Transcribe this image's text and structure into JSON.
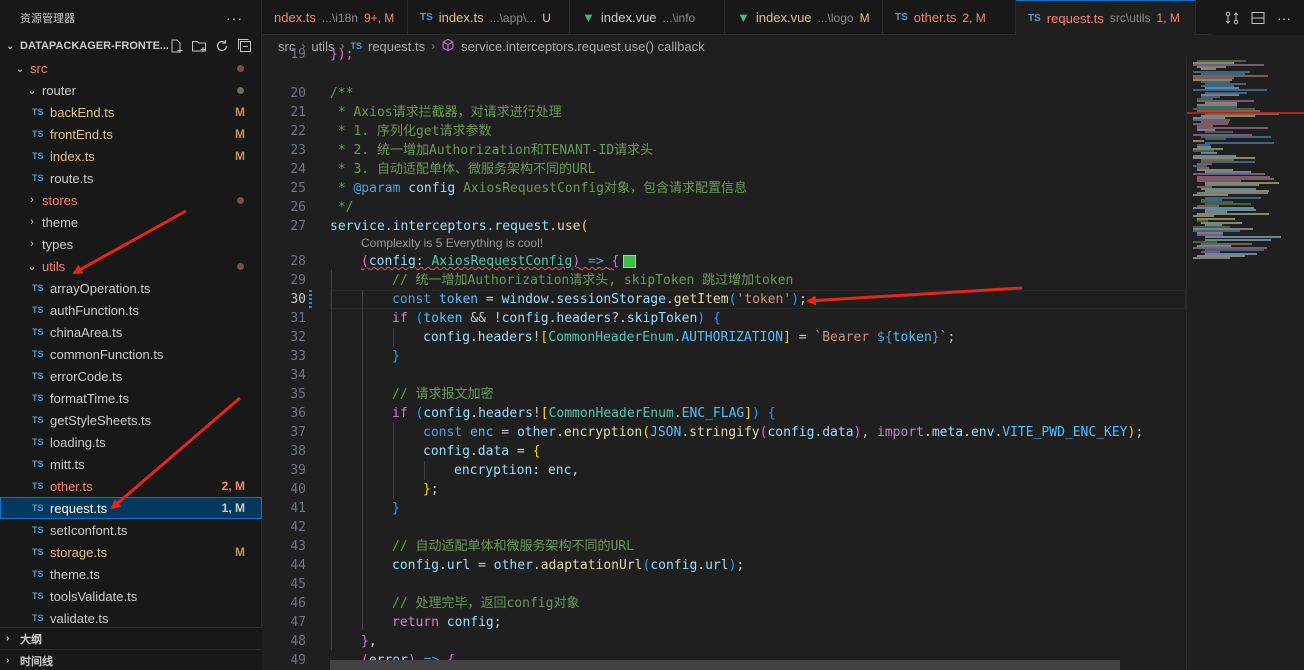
{
  "explorer": {
    "title": "资源管理器",
    "more_icon": "ellipsis-icon",
    "project_name": "DATAPACKAGER-FRONTE...",
    "project_actions": [
      "new-file-icon",
      "new-folder-icon",
      "refresh-icon",
      "collapse-all-icon"
    ],
    "tree": [
      {
        "label": "src",
        "kind": "folder-open",
        "depth": 1,
        "state": "err",
        "dot": true
      },
      {
        "label": "router",
        "kind": "folder-open",
        "depth": 2,
        "state": "",
        "dot": true,
        "dotgray": true
      },
      {
        "label": "backEnd.ts",
        "kind": "ts",
        "depth": 3,
        "state": "mod",
        "badge": "M"
      },
      {
        "label": "frontEnd.ts",
        "kind": "ts",
        "depth": 3,
        "state": "mod",
        "badge": "M"
      },
      {
        "label": "index.ts",
        "kind": "ts",
        "depth": 3,
        "state": "mod",
        "badge": "M"
      },
      {
        "label": "route.ts",
        "kind": "ts",
        "depth": 3,
        "state": "",
        "badge": ""
      },
      {
        "label": "stores",
        "kind": "folder",
        "depth": 2,
        "state": "err",
        "dot": true
      },
      {
        "label": "theme",
        "kind": "folder",
        "depth": 2,
        "state": ""
      },
      {
        "label": "types",
        "kind": "folder",
        "depth": 2,
        "state": ""
      },
      {
        "label": "utils",
        "kind": "folder-open",
        "depth": 2,
        "state": "err",
        "dot": true
      },
      {
        "label": "arrayOperation.ts",
        "kind": "ts",
        "depth": 3,
        "state": ""
      },
      {
        "label": "authFunction.ts",
        "kind": "ts",
        "depth": 3,
        "state": ""
      },
      {
        "label": "chinaArea.ts",
        "kind": "ts",
        "depth": 3,
        "state": ""
      },
      {
        "label": "commonFunction.ts",
        "kind": "ts",
        "depth": 3,
        "state": ""
      },
      {
        "label": "errorCode.ts",
        "kind": "ts",
        "depth": 3,
        "state": ""
      },
      {
        "label": "formatTime.ts",
        "kind": "ts",
        "depth": 3,
        "state": ""
      },
      {
        "label": "getStyleSheets.ts",
        "kind": "ts",
        "depth": 3,
        "state": ""
      },
      {
        "label": "loading.ts",
        "kind": "ts",
        "depth": 3,
        "state": ""
      },
      {
        "label": "mitt.ts",
        "kind": "ts",
        "depth": 3,
        "state": ""
      },
      {
        "label": "other.ts",
        "kind": "ts",
        "depth": 3,
        "state": "err",
        "badge": "2, M"
      },
      {
        "label": "request.ts",
        "kind": "ts",
        "depth": 3,
        "state": "sel",
        "badge": "1, M"
      },
      {
        "label": "setIconfont.ts",
        "kind": "ts",
        "depth": 3,
        "state": ""
      },
      {
        "label": "storage.ts",
        "kind": "ts",
        "depth": 3,
        "state": "mod",
        "badge": "M"
      },
      {
        "label": "theme.ts",
        "kind": "ts",
        "depth": 3,
        "state": ""
      },
      {
        "label": "toolsValidate.ts",
        "kind": "ts",
        "depth": 3,
        "state": ""
      },
      {
        "label": "validate.ts",
        "kind": "ts",
        "depth": 3,
        "state": ""
      }
    ],
    "ts_badge": "TS",
    "outline_label": "大纲",
    "timeline_label": "时间线"
  },
  "tabs": [
    {
      "icon": "",
      "name": "ndex.ts",
      "path": "...\\i18n",
      "status": "9+, M",
      "kind": "err"
    },
    {
      "icon": "TS",
      "name": "index.ts",
      "path": "...\\app\\...",
      "status": "U",
      "kind": "mod"
    },
    {
      "icon": "vue",
      "name": "index.vue",
      "path": "...\\info",
      "status": "",
      "kind": "plain"
    },
    {
      "icon": "vue",
      "name": "index.vue",
      "path": "...\\logo",
      "status": "M",
      "kind": "mod"
    },
    {
      "icon": "TS",
      "name": "other.ts",
      "path": "",
      "status": "2, M",
      "kind": "err"
    },
    {
      "icon": "TS",
      "name": "request.ts",
      "path": "src\\utils",
      "status": "1, M",
      "kind": "active"
    }
  ],
  "tab_actions": [
    "source-control-compare-icon",
    "split-editor-icon",
    "more-actions-icon"
  ],
  "breadcrumb": {
    "items": [
      "src",
      "utils",
      "request.ts",
      "service.interceptors.request.use() callback"
    ],
    "ts_badge": "TS"
  },
  "editor": {
    "line_numbers": [
      "19",
      "20",
      "21",
      "22",
      "23",
      "24",
      "25",
      "26",
      "27",
      "28",
      "29",
      "30",
      "31",
      "32",
      "33",
      "34",
      "35",
      "36",
      "37",
      "38",
      "39",
      "40",
      "41",
      "42",
      "43",
      "44",
      "45",
      "46",
      "47",
      "48",
      "49"
    ],
    "codelens": "Complexity is 5 Everything is cool!",
    "lines": {
      "l19": "});",
      "l20": "/**",
      "l21": " * Axios请求拦截器，对请求进行处理",
      "l22": " * 1. 序列化get请求参数",
      "l23": " * 2. 统一增加Authorization和TENANT-ID请求头",
      "l24": " * 3. 自动适配单体、微服务架构不同的URL",
      "l25a": " * ",
      "l25b": "@param",
      "l25c": " config",
      "l25d": " AxiosRequestConfig对象，包含请求配置信息",
      "l26": " */",
      "l27a": "service",
      "l27b": ".",
      "l27c": "interceptors",
      "l27d": ".",
      "l27e": "request",
      "l27f": ".",
      "l27g": "use",
      "l27h": "(",
      "l28a": "(",
      "l28b": "config",
      "l28c": ": ",
      "l28d": "AxiosRequestConfig",
      "l28e": ")",
      "l28f": " => ",
      "l28g": "{",
      "l29": "// 统一增加Authorization请求头, skipToken 跳过增加token",
      "l30a": "const",
      "l30b": " token",
      "l30c": " = ",
      "l30d": "window",
      "l30e": ".",
      "l30f": "sessionStorage",
      "l30g": ".",
      "l30h": "getItem",
      "l30i": "(",
      "l30j": "'token'",
      "l30k": ")",
      "l30l": ";",
      "l31a": "if",
      "l31b": " (",
      "l31c": "token",
      "l31d": " && !",
      "l31e": "config",
      "l31f": ".",
      "l31g": "headers",
      "l31h": "?.",
      "l31i": "skipToken",
      "l31j": ")",
      "l31k": " {",
      "l32a": "config",
      "l32b": ".",
      "l32c": "headers",
      "l32d": "!",
      "l32e": "[",
      "l32f": "CommonHeaderEnum",
      "l32g": ".",
      "l32h": "AUTHORIZATION",
      "l32i": "]",
      "l32j": " = ",
      "l32k": "`Bearer ",
      "l32l": "${",
      "l32m": "token",
      "l32n": "}",
      "l32o": "`",
      "l32p": ";",
      "l33": "}",
      "l35": "// 请求报文加密",
      "l36a": "if",
      "l36b": " (",
      "l36c": "config",
      "l36d": ".",
      "l36e": "headers",
      "l36f": "!",
      "l36g": "[",
      "l36h": "CommonHeaderEnum",
      "l36i": ".",
      "l36j": "ENC_FLAG",
      "l36k": "]",
      "l36l": ")",
      "l36m": " {",
      "l37a": "const",
      "l37b": " enc",
      "l37c": " = ",
      "l37d": "other",
      "l37e": ".",
      "l37f": "encryption",
      "l37g": "(",
      "l37h": "JSON",
      "l37i": ".",
      "l37j": "stringify",
      "l37k": "(",
      "l37l": "config",
      "l37m": ".",
      "l37n": "data",
      "l37o": ")",
      "l37p": ", ",
      "l37q": "import",
      "l37r": ".",
      "l37s": "meta",
      "l37t": ".",
      "l37u": "env",
      "l37v": ".",
      "l37w": "VITE_PWD_ENC_KEY",
      "l37x": ")",
      "l37y": ";",
      "l38a": "config",
      "l38b": ".",
      "l38c": "data",
      "l38d": " = ",
      "l38e": "{",
      "l39a": "encryption",
      "l39b": ": ",
      "l39c": "enc",
      "l39d": ",",
      "l40a": "}",
      "l40b": ";",
      "l41": "}",
      "l43": "// 自动适配单体和微服务架构不同的URL",
      "l44a": "config",
      "l44b": ".",
      "l44c": "url",
      "l44d": " = ",
      "l44e": "other",
      "l44f": ".",
      "l44g": "adaptationUrl",
      "l44h": "(",
      "l44i": "config",
      "l44j": ".",
      "l44k": "url",
      "l44l": ")",
      "l44m": ";",
      "l46": "// 处理完毕，返回config对象",
      "l47a": "return",
      "l47b": " config",
      "l47c": ";",
      "l48a": "}",
      "l48b": ",",
      "l49a": "(",
      "l49b": "error",
      "l49c": ")",
      "l49d": " => ",
      "l49e": "{"
    }
  },
  "colors": {
    "accent": "#0078d4",
    "annotation_arrow": "#e8241b",
    "modified": "#e2c08d",
    "error": "#f88070"
  }
}
